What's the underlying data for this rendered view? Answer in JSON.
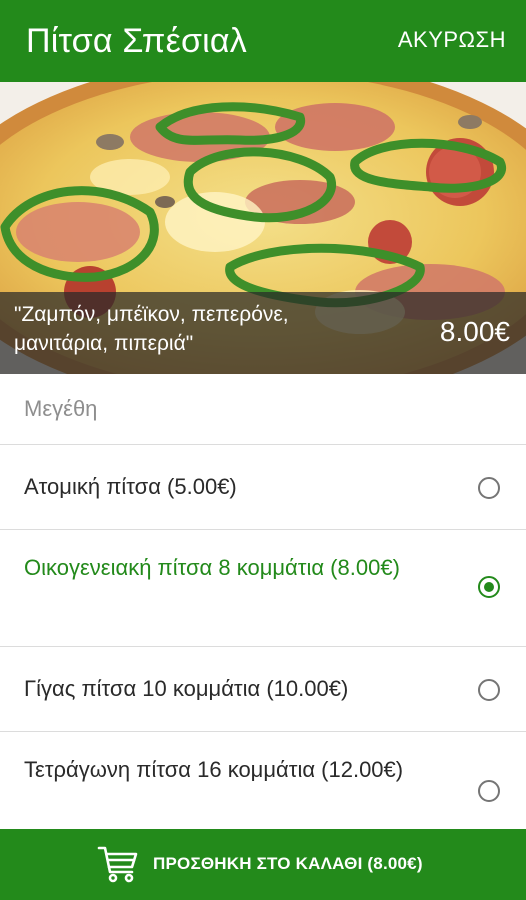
{
  "header": {
    "title": "Πίτσα Σπέσιαλ",
    "cancel_label": "ΑΚΥΡΩΣΗ"
  },
  "product": {
    "description": "\"Ζαμπόν, μπέϊκον, πεπερόνε, μανιτάρια, πιπεριά\"",
    "price": "8.00€"
  },
  "sizes": {
    "header": "Μεγέθη",
    "options": [
      {
        "label": "Ατομική πίτσα (5.00€)",
        "selected": false
      },
      {
        "label": "Οικογενειακή πίτσα 8 κομμάτια (8.00€)",
        "selected": true
      },
      {
        "label": "Γίγας πίτσα 10 κομμάτια (10.00€)",
        "selected": false
      },
      {
        "label": "Τετράγωνη πίτσα 16 κομμάτια (12.00€)",
        "selected": false
      }
    ]
  },
  "footer": {
    "add_to_cart_label": "ΠΡΟΣΘΗΚΗ ΣΤΟ ΚΑΛΑΘΙ (8.00€)",
    "cart_icon": "shopping-cart-icon"
  },
  "colors": {
    "accent": "#238a1b",
    "text": "#2a2a2a",
    "muted": "#8e8e8e"
  }
}
